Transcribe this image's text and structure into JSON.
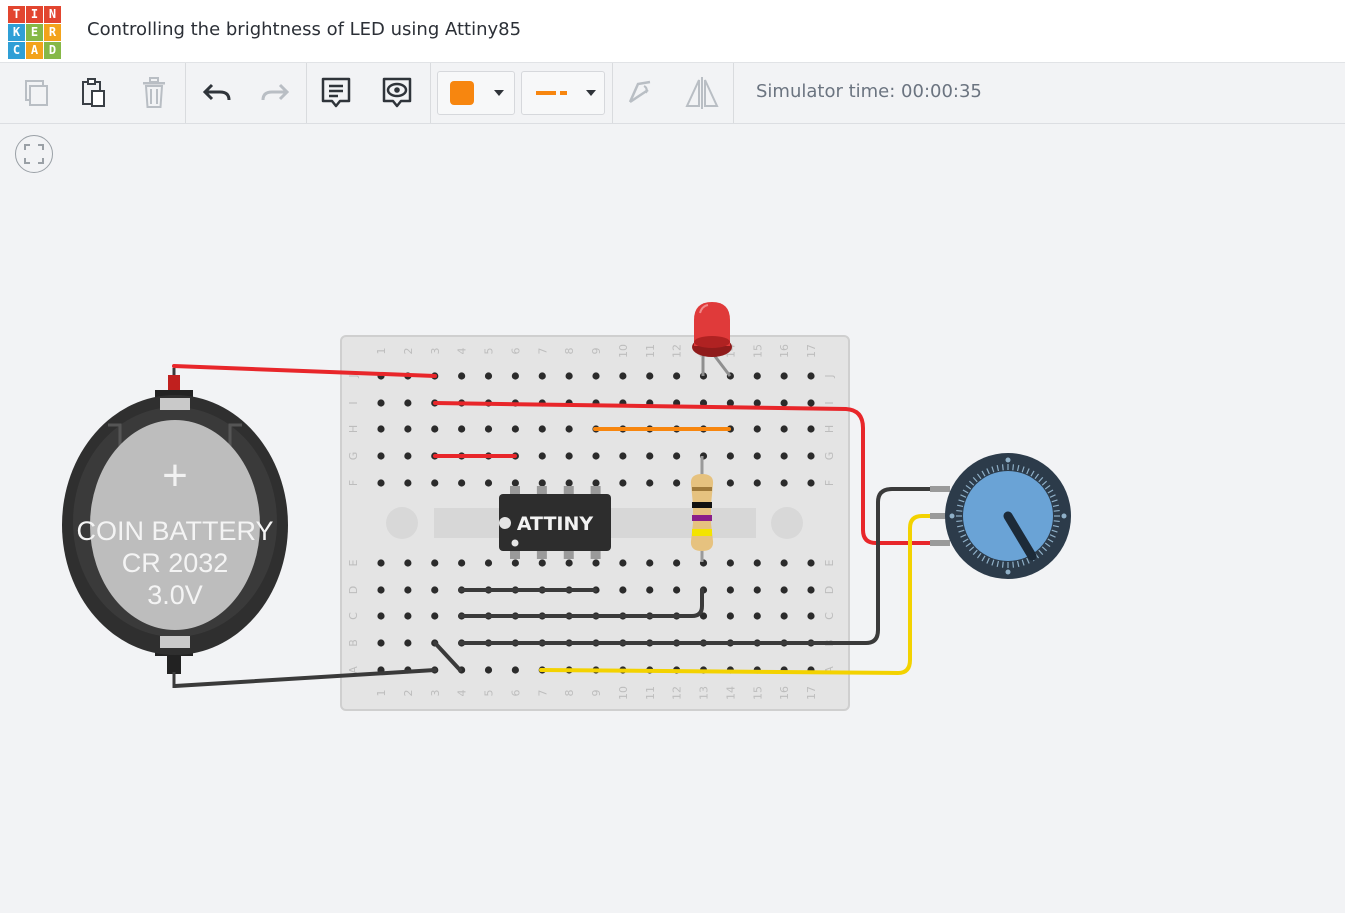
{
  "app": {
    "logo_letters": [
      "T",
      "I",
      "N",
      "K",
      "E",
      "R",
      "C",
      "A",
      "D"
    ],
    "logo_colors": [
      "#e2452f",
      "#e2452f",
      "#e2452f",
      "#2f9fd6",
      "#86b847",
      "#f3a31b",
      "#2f9fd6",
      "#f3a31b",
      "#86b847"
    ],
    "title": "Controlling the brightness of LED using Attiny85"
  },
  "toolbar": {
    "copy_icon": "copy-icon",
    "paste_icon": "paste-icon",
    "delete_icon": "trash-icon",
    "undo_icon": "undo-icon",
    "redo_icon": "redo-icon",
    "notes_icon": "notes-icon",
    "toggle_notes_icon": "eye-speech-icon",
    "wire_color": "#f7860f",
    "wire_type_icon": "dashed-line-icon",
    "rotate_icon": "rotate-icon",
    "flip_icon": "flip-icon",
    "simulator_time": "Simulator time: 00:00:35"
  },
  "canvas": {
    "fit_view_icon": "fit-view-icon",
    "breadboard_columns": [
      "1",
      "2",
      "3",
      "4",
      "5",
      "6",
      "7",
      "8",
      "9",
      "10",
      "11",
      "12",
      "13",
      "14",
      "15",
      "16",
      "17"
    ],
    "breadboard_rows_top": [
      "J",
      "I",
      "H",
      "G",
      "F"
    ],
    "breadboard_rows_bottom": [
      "E",
      "D",
      "C",
      "B",
      "A"
    ],
    "battery": {
      "line1": "COIN BATTERY",
      "line2": "CR 2032",
      "line3": "3.0V",
      "plus": "+"
    },
    "chip": {
      "label": "ATTINY"
    },
    "colors": {
      "red_wire": "#e8262a",
      "black_wire": "#3a3a3a",
      "yellow_wire": "#f3d200",
      "orange_wire": "#f7860f",
      "pot_blue": "#6aa3d6"
    }
  }
}
